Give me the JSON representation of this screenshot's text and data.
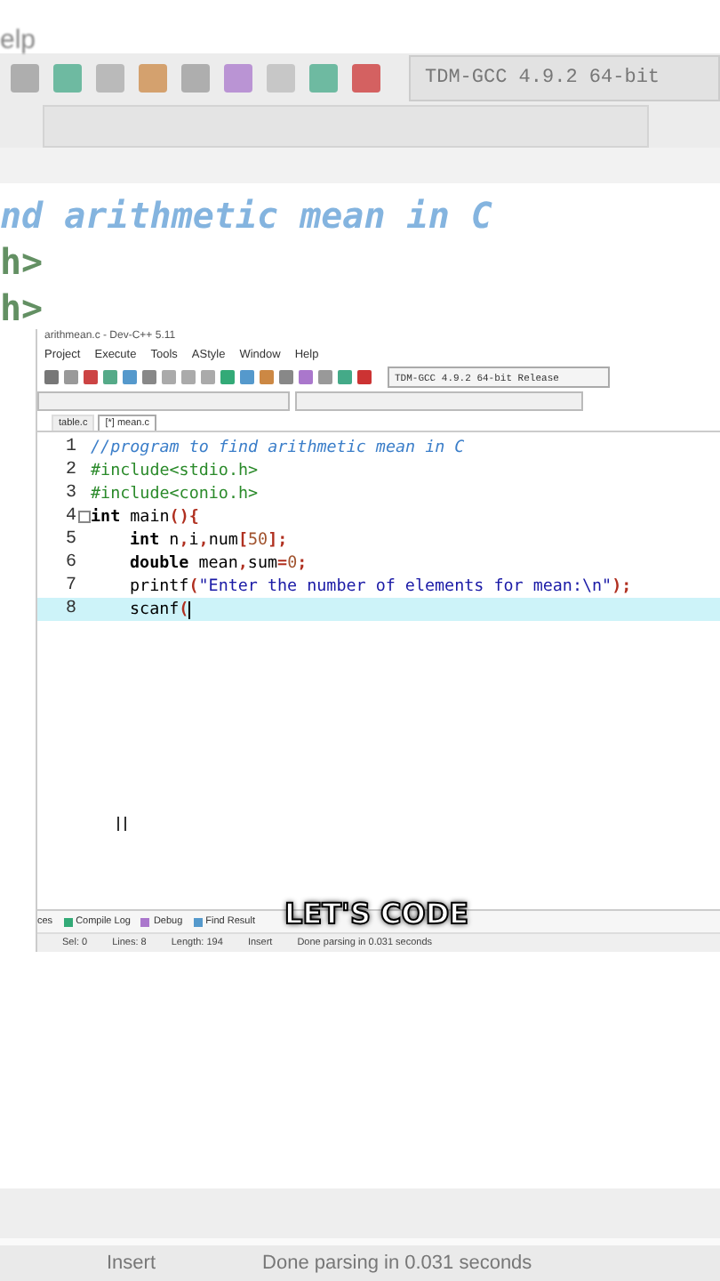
{
  "background": {
    "menu_fragment": "elp",
    "compiler": "TDM-GCC 4.9.2 64-bit",
    "code_lines": [
      "nd arithmetic mean in C",
      "h>",
      "h>"
    ],
    "status": {
      "mode": "Insert",
      "message": "Done parsing in 0.031 seconds"
    }
  },
  "window": {
    "title": "arithmean.c - Dev-C++ 5.11",
    "menu": [
      "Project",
      "Execute",
      "Tools",
      "AStyle",
      "Window",
      "Help"
    ],
    "compiler": "TDM-GCC 4.9.2 64-bit Release",
    "tabs": [
      {
        "label": "table.c",
        "selected": false
      },
      {
        "label": "[*] mean.c",
        "selected": true
      }
    ],
    "code": [
      {
        "number": "1",
        "fold": false,
        "current": false,
        "indented": false,
        "segments": [
          {
            "kind": "comment",
            "text": "//program to find arithmetic mean in C"
          }
        ]
      },
      {
        "number": "2",
        "fold": false,
        "current": false,
        "indented": false,
        "segments": [
          {
            "kind": "preproc",
            "text": "#include<stdio.h>"
          }
        ]
      },
      {
        "number": "3",
        "fold": false,
        "current": false,
        "indented": false,
        "segments": [
          {
            "kind": "preproc",
            "text": "#include<conio.h>"
          }
        ]
      },
      {
        "number": "4",
        "fold": true,
        "current": false,
        "indented": false,
        "segments": [
          {
            "kind": "keyword",
            "text": "int"
          },
          {
            "kind": "plain",
            "text": " main"
          },
          {
            "kind": "symbol",
            "text": "(){"
          }
        ]
      },
      {
        "number": "5",
        "fold": false,
        "current": false,
        "indented": true,
        "segments": [
          {
            "kind": "keyword",
            "text": "int"
          },
          {
            "kind": "plain",
            "text": " n"
          },
          {
            "kind": "symbol",
            "text": ","
          },
          {
            "kind": "plain",
            "text": "i"
          },
          {
            "kind": "symbol",
            "text": ","
          },
          {
            "kind": "plain",
            "text": "num"
          },
          {
            "kind": "symbol",
            "text": "["
          },
          {
            "kind": "number",
            "text": "50"
          },
          {
            "kind": "symbol",
            "text": "];"
          }
        ]
      },
      {
        "number": "6",
        "fold": false,
        "current": false,
        "indented": true,
        "segments": [
          {
            "kind": "keyword",
            "text": "double"
          },
          {
            "kind": "plain",
            "text": " mean"
          },
          {
            "kind": "symbol",
            "text": ","
          },
          {
            "kind": "plain",
            "text": "sum"
          },
          {
            "kind": "symbol",
            "text": "="
          },
          {
            "kind": "number",
            "text": "0"
          },
          {
            "kind": "symbol",
            "text": ";"
          }
        ]
      },
      {
        "number": "7",
        "fold": false,
        "current": false,
        "indented": true,
        "segments": [
          {
            "kind": "plain",
            "text": "printf"
          },
          {
            "kind": "symbol",
            "text": "("
          },
          {
            "kind": "string",
            "text": "\"Enter the number of elements for mean:\\n\""
          },
          {
            "kind": "symbol",
            "text": ");"
          }
        ]
      },
      {
        "number": "8",
        "fold": false,
        "current": true,
        "indented": true,
        "segments": [
          {
            "kind": "plain",
            "text": "scanf"
          },
          {
            "kind": "symbol",
            "text": "("
          }
        ]
      }
    ],
    "bottom_tabs": [
      "ces",
      "Compile Log",
      "Debug",
      "Find Result"
    ],
    "status": [
      {
        "label": "Sel:",
        "value": "0"
      },
      {
        "label": "Lines:",
        "value": "8"
      },
      {
        "label": "Length:",
        "value": "194"
      }
    ],
    "status_mode": "Insert",
    "status_message": "Done parsing in 0.031 seconds"
  },
  "caption": "LET'S CODE"
}
